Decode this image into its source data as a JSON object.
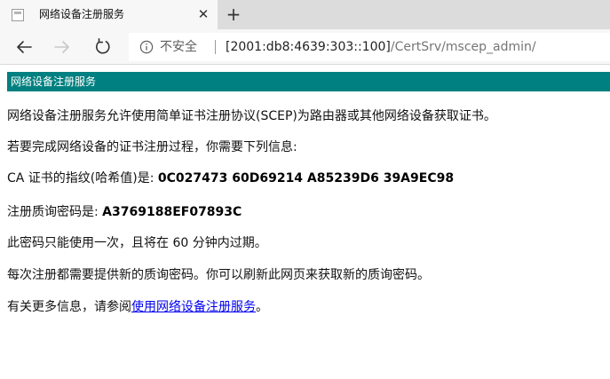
{
  "browser": {
    "tab": {
      "title": "网络设备注册服务",
      "close_glyph": "✕",
      "favicon": "page-icon"
    },
    "new_tab_glyph": "+",
    "toolbar": {
      "back_icon": "back-arrow-icon",
      "forward_icon": "forward-arrow-icon",
      "reload_icon": "reload-icon"
    },
    "address": {
      "security_icon": "info-icon",
      "security_label": "不安全",
      "url_host": "[2001:db8:4639:303::100]",
      "url_path": "/CertSrv/mscep_admin/"
    }
  },
  "page": {
    "header_title": "网络设备注册服务",
    "intro": "网络设备注册服务允许使用简单证书注册协议(SCEP)为路由器或其他网络设备获取证书。",
    "instruction": "若要完成网络设备的证书注册过程，你需要下列信息:",
    "thumbprint_label": "CA 证书的指纹(哈希值)是: ",
    "thumbprint_value": "0C027473 60D69214 A85239D6 39A9EC98",
    "challenge_label": "注册质询密码是: ",
    "challenge_value": "A3769188EF07893C",
    "expiry_note": "此密码只能使用一次，且将在 60 分钟内过期。",
    "refresh_note": "每次注册都需要提供新的质询密码。你可以刷新此网页来获取新的质询密码。",
    "more_info_prefix": "有关更多信息，请参阅",
    "more_info_link": "使用网络设备注册服务",
    "more_info_suffix": "。"
  },
  "colors": {
    "header_bg": "#008080",
    "link": "#0000ee",
    "tabstrip_bg": "#dcdcdc",
    "toolbar_bg": "#f7f7f7"
  }
}
